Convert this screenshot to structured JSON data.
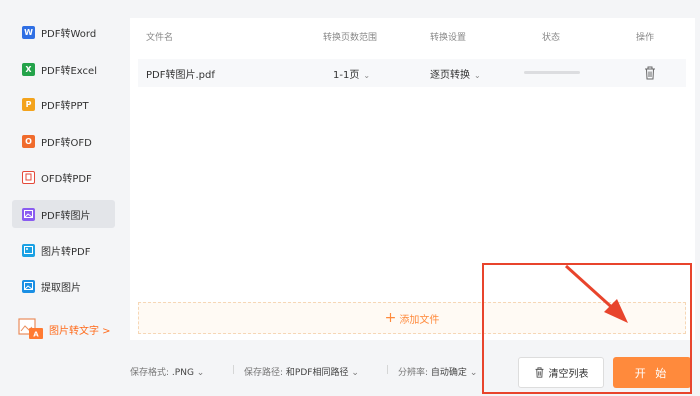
{
  "sidebar": {
    "items": [
      {
        "label": "PDF转Word",
        "icon_text": "W",
        "color": "#2f6fe4",
        "active": false
      },
      {
        "label": "PDF转Excel",
        "icon_text": "X",
        "color": "#24a34a",
        "active": false
      },
      {
        "label": "PDF转PPT",
        "icon_text": "P",
        "color": "#f3a31c",
        "active": false
      },
      {
        "label": "PDF转OFD",
        "icon_text": "O",
        "color": "#f06b2c",
        "active": false
      },
      {
        "label": "OFD转PDF",
        "icon_text": "",
        "color": "#e4493a",
        "active": false
      },
      {
        "label": "PDF转图片",
        "icon_text": "",
        "color": "#8a5cf0",
        "active": true
      },
      {
        "label": "图片转PDF",
        "icon_text": "",
        "color": "#1aa1e4",
        "active": false
      },
      {
        "label": "提取图片",
        "icon_text": "",
        "color": "#1a8fe4",
        "active": false
      }
    ],
    "ocr": {
      "label": "图片转文字 >"
    }
  },
  "table": {
    "headers": {
      "filename": "文件名",
      "page_range": "转换页数范围",
      "settings": "转换设置",
      "status": "状态",
      "action": "操作"
    },
    "rows": [
      {
        "filename": "PDF转图片.pdf",
        "page_range": "1-1页",
        "settings": "逐页转换",
        "progress": 0
      }
    ]
  },
  "add_file": {
    "label": "添加文件",
    "plus": "+"
  },
  "bottom": {
    "format_label": "保存格式:",
    "format_value": ".PNG",
    "path_label": "保存路径:",
    "path_value": "和PDF相同路径",
    "resolution_label": "分辨率:",
    "resolution_value": "自动确定",
    "caret": "⌄"
  },
  "buttons": {
    "clear": "清空列表",
    "start": "开 始"
  },
  "colors": {
    "accent": "#ff8a3c",
    "annotation": "#e8442c"
  }
}
